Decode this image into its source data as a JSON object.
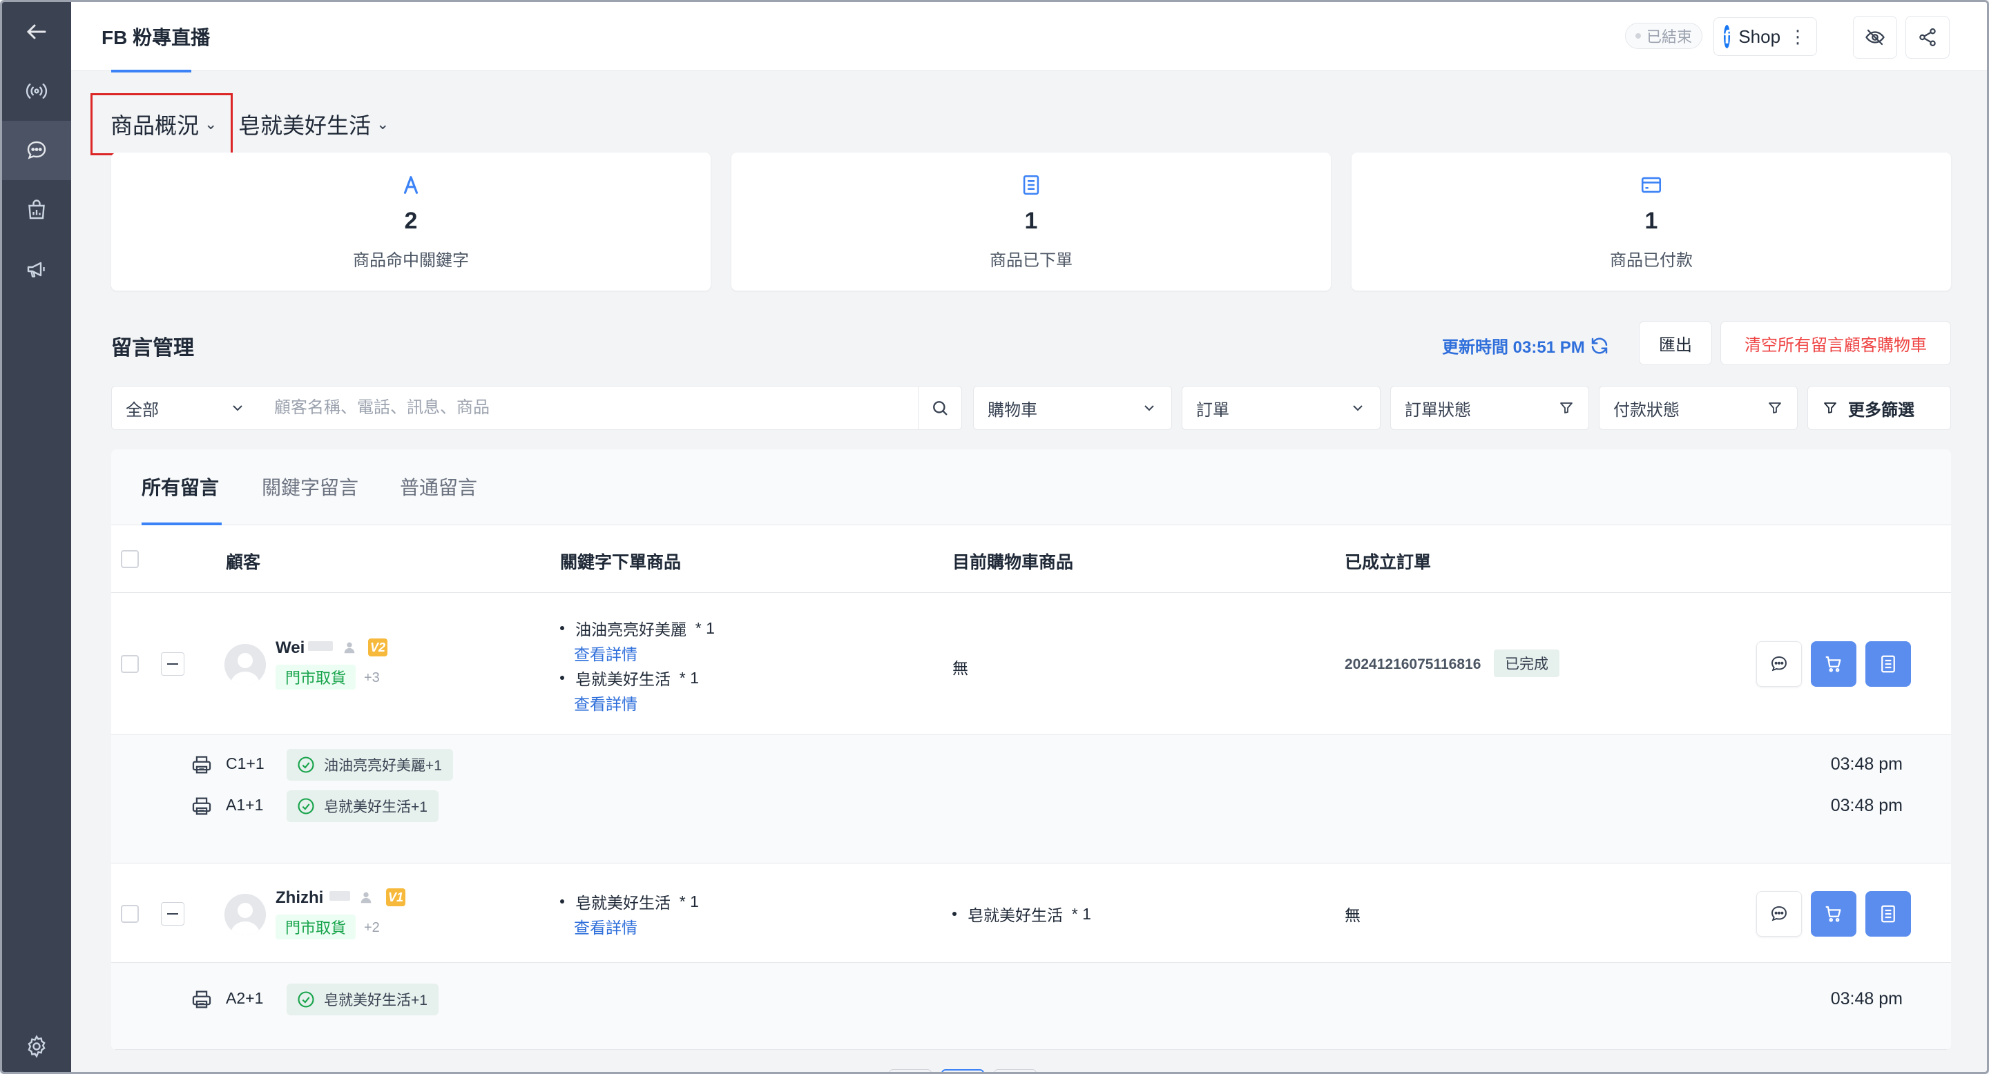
{
  "header": {
    "title": "FB 粉專直播",
    "status": "已結束",
    "shop_label": "Shop",
    "shop_more": "⋮"
  },
  "overview": {
    "selector_label": "商品概況",
    "product_label": "皂就美好生活",
    "stats": [
      {
        "icon": "keyword-a-icon",
        "value": "2",
        "label": "商品命中關鍵字"
      },
      {
        "icon": "clipboard-icon",
        "value": "1",
        "label": "商品已下單"
      },
      {
        "icon": "credit-card-icon",
        "value": "1",
        "label": "商品已付款"
      }
    ]
  },
  "comments": {
    "title": "留言管理",
    "update_time": "更新時間 03:51 PM",
    "export_label": "匯出",
    "clear_label": "清空所有留言顧客購物車",
    "filters": {
      "scope": "全部",
      "search_placeholder": "顧客名稱、電話、訊息、商品",
      "cart": "購物車",
      "order": "訂單",
      "order_status": "訂單狀態",
      "payment_status": "付款狀態",
      "more": "更多篩選"
    },
    "tabs": [
      "所有留言",
      "關鍵字留言",
      "普通留言"
    ],
    "columns": [
      "顧客",
      "關鍵字下單商品",
      "目前購物車商品",
      "已成立訂單"
    ],
    "rows": [
      {
        "name": "Wei",
        "vip": "V2",
        "tag": "門市取貨",
        "more": "+3",
        "keyword_items": [
          {
            "name": "油油亮亮好美麗",
            "qty": "* 1",
            "link": "查看詳情"
          },
          {
            "name": "皂就美好生活",
            "qty": "* 1",
            "link": "查看詳情"
          }
        ],
        "cart": "無",
        "order_no": "20241216075116816",
        "order_status": "已完成",
        "comments": [
          {
            "code": "C1+1",
            "tag": "油油亮亮好美麗+1",
            "time": "03:48 pm"
          },
          {
            "code": "A1+1",
            "tag": "皂就美好生活+1",
            "time": "03:48 pm"
          }
        ]
      },
      {
        "name": "Zhizhi",
        "vip": "V1",
        "tag": "門市取貨",
        "more": "+2",
        "keyword_items": [
          {
            "name": "皂就美好生活",
            "qty": "* 1",
            "link": "查看詳情"
          }
        ],
        "cart_items": [
          {
            "name": "皂就美好生活",
            "qty": "* 1"
          }
        ],
        "order": "無",
        "comments": [
          {
            "code": "A2+1",
            "tag": "皂就美好生活+1",
            "time": "03:48 pm"
          }
        ]
      }
    ]
  },
  "colors": {
    "sidebar": "#3b4252",
    "accent": "#2f6fdb",
    "danger": "#ef4444",
    "action_blue": "#5b8def",
    "highlight_border": "#dc2626"
  }
}
